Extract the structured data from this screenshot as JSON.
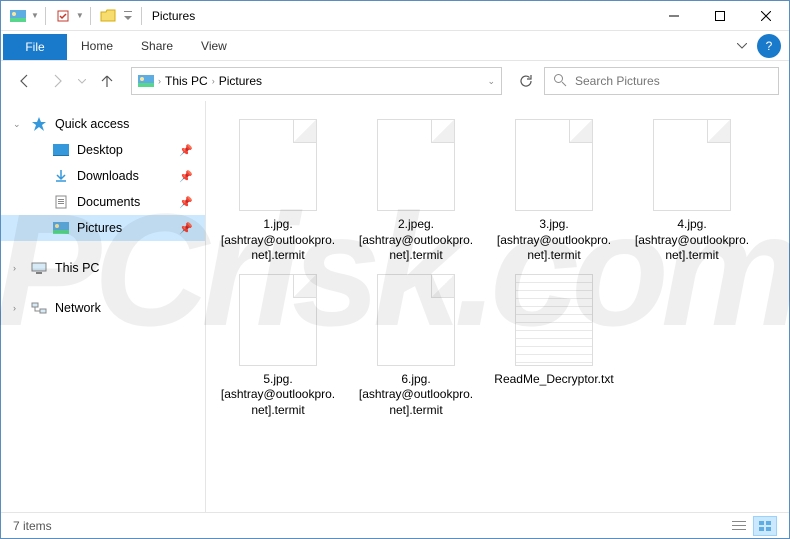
{
  "titlebar": {
    "title": "Pictures"
  },
  "ribbon": {
    "file": "File",
    "tabs": [
      "Home",
      "Share",
      "View"
    ]
  },
  "breadcrumb": {
    "path": [
      "This PC",
      "Pictures"
    ]
  },
  "search": {
    "placeholder": "Search Pictures"
  },
  "sidebar": {
    "quick_access": "Quick access",
    "items": [
      {
        "label": "Desktop",
        "pinned": true
      },
      {
        "label": "Downloads",
        "pinned": true
      },
      {
        "label": "Documents",
        "pinned": true
      },
      {
        "label": "Pictures",
        "pinned": true,
        "selected": true
      }
    ],
    "this_pc": "This PC",
    "network": "Network"
  },
  "files": [
    {
      "name": "1.jpg.[ashtray@outlookpro.net].termit",
      "type": "file"
    },
    {
      "name": "2.jpeg.[ashtray@outlookpro.net].termit",
      "type": "file"
    },
    {
      "name": "3.jpg.[ashtray@outlookpro.net].termit",
      "type": "file"
    },
    {
      "name": "4.jpg.[ashtray@outlookpro.net].termit",
      "type": "file"
    },
    {
      "name": "5.jpg.[ashtray@outlookpro.net].termit",
      "type": "file"
    },
    {
      "name": "6.jpg.[ashtray@outlookpro.net].termit",
      "type": "file"
    },
    {
      "name": "ReadMe_Decryptor.txt",
      "type": "txt"
    }
  ],
  "statusbar": {
    "count": "7 items"
  }
}
